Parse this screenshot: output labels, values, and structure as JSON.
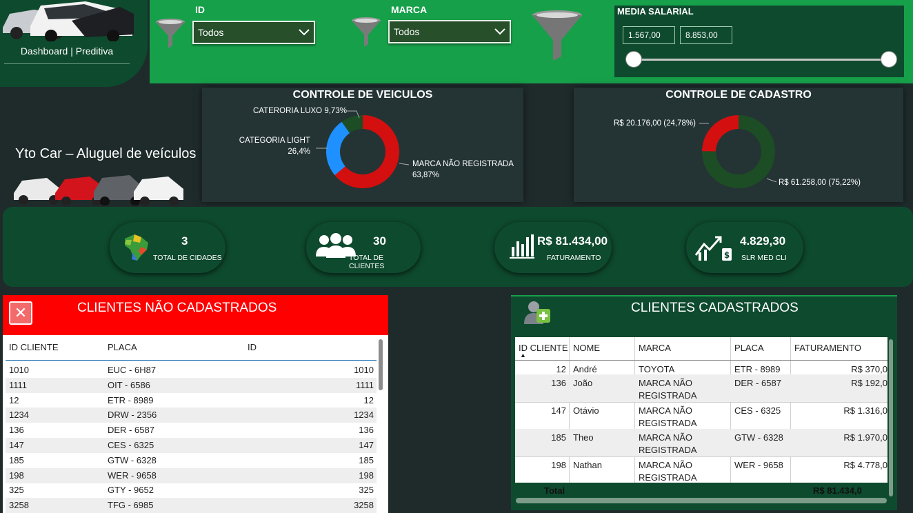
{
  "nav": {
    "label": "Dashboard | Preditiva"
  },
  "filters": {
    "id": {
      "label": "ID",
      "value": "Todos"
    },
    "marca": {
      "label": "MARCA",
      "value": "Todos"
    },
    "salary": {
      "label": "MEDIA SALARIAL",
      "min": "1.567,00",
      "max": "8.853,00"
    }
  },
  "brand": {
    "title": "Yto Car – Aluguel de veículos"
  },
  "charts": {
    "veiculos": {
      "title": "CONTROLE DE VEICULOS"
    },
    "cadastro": {
      "title": "CONTROLE DE CADASTRO"
    }
  },
  "chart_data": [
    {
      "type": "pie",
      "title": "CONTROLE DE VEICULOS",
      "slices": [
        {
          "label": "MARCA NÃO REGISTRADA",
          "value": 63.87,
          "display": "63,87%",
          "color": "#d40f0f"
        },
        {
          "label": "CATEGORIA LIGHT",
          "value": 26.4,
          "display": "26,4%",
          "color": "#1e90ff"
        },
        {
          "label": "CATERORIA LUXO",
          "value": 9.73,
          "display": "9,73%",
          "color": "#1d4d24"
        }
      ]
    },
    {
      "type": "pie",
      "title": "CONTROLE DE CADASTRO",
      "slices": [
        {
          "label": "R$ 61.258,00 (75,22%)",
          "value": 75.22,
          "color": "#1d4d24"
        },
        {
          "label": "R$ 20.176,00 (24,78%)",
          "value": 24.78,
          "color": "#d40f0f"
        }
      ]
    }
  ],
  "kpis": [
    {
      "value": "3",
      "label": "TOTAL DE CIDADES",
      "icon": "brazil-map-icon"
    },
    {
      "value": "30",
      "label": "TOTAL DE CLIENTES",
      "icon": "people-icon"
    },
    {
      "value": "R$ 81.434,00",
      "label": "FATURAMENTO",
      "icon": "bar-chart-icon"
    },
    {
      "value": "4.829,30",
      "label": "SLR MED CLI",
      "icon": "growth-money-icon"
    }
  ],
  "nao_cadastrados": {
    "title": "CLIENTES NÃO CADASTRADOS",
    "headers": [
      "ID CLIENTE",
      "PLACA",
      "ID"
    ],
    "rows": [
      [
        "1010",
        "EUC - 6H87",
        "1010"
      ],
      [
        "1111",
        "OIT - 6586",
        "1111"
      ],
      [
        "12",
        "ETR - 8989",
        "12"
      ],
      [
        "1234",
        "DRW - 2356",
        "1234"
      ],
      [
        "136",
        "DER - 6587",
        "136"
      ],
      [
        "147",
        "CES - 6325",
        "147"
      ],
      [
        "185",
        "GTW - 6328",
        "185"
      ],
      [
        "198",
        "WER - 9658",
        "198"
      ],
      [
        "325",
        "GTY - 9652",
        "325"
      ],
      [
        "3258",
        "TFG - 6985",
        "3258"
      ]
    ]
  },
  "cadastrados": {
    "title": "CLIENTES CADASTRADOS",
    "headers": [
      "ID CLIENTE",
      "NOME",
      "MARCA",
      "PLACA",
      "FATURAMENTO"
    ],
    "sort_marker": "▲",
    "rows": [
      [
        "12",
        "André",
        "TOYOTA",
        "",
        "ETR - 8989",
        "R$ 370,0"
      ],
      [
        "136",
        "João",
        "MARCA NÃO",
        "REGISTRADA",
        "DER - 6587",
        "R$ 192,0"
      ],
      [
        "147",
        "Otávio",
        "MARCA NÃO",
        "REGISTRADA",
        "CES - 6325",
        "R$ 1.316,0"
      ],
      [
        "185",
        "Theo",
        "MARCA NÃO",
        "REGISTRADA",
        "GTW - 6328",
        "R$ 1.970,0"
      ],
      [
        "198",
        "Nathan",
        "MARCA NÃO",
        "REGISTRADA",
        "WER - 9658",
        "R$ 4.778,0"
      ]
    ],
    "total_label": "Total",
    "total_value": "R$ 81.434,0"
  }
}
